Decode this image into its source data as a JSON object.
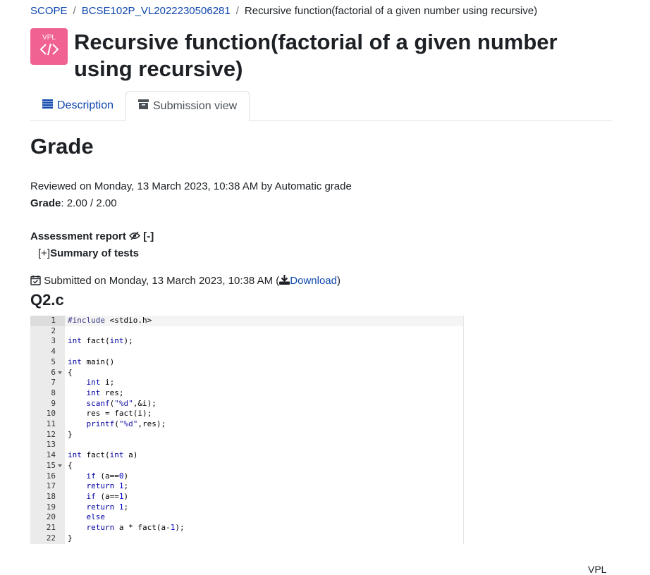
{
  "breadcrumb": {
    "items": [
      "SCOPE",
      "BCSE102P_VL2022230506281",
      "Recursive function(factorial of a given number using recursive)"
    ],
    "separator": "/"
  },
  "activity": {
    "logo_text": "VPL",
    "title": "Recursive function(factorial of a given number using recursive)"
  },
  "tabs": [
    {
      "label": "Description",
      "icon": "list-icon",
      "active": false
    },
    {
      "label": "Submission view",
      "icon": "archive-box-icon",
      "active": true
    }
  ],
  "grade": {
    "heading": "Grade",
    "reviewed_text": "Reviewed on Monday, 13 March 2023, 10:38 AM by Automatic grade",
    "grade_label": "Grade",
    "grade_value": ": 2.00 / 2.00"
  },
  "assessment": {
    "title": "Assessment report",
    "collapse_label": "[-]",
    "summary_toggle": "[+]",
    "summary_label": "Summary of tests"
  },
  "submission": {
    "submitted_text": "Submitted on Monday, 13 March 2023, 10:38 AM (",
    "download_label": "Download",
    "close_paren": ")",
    "filename": "Q2.c"
  },
  "code": {
    "line_numbers": [
      "1",
      "2",
      "3",
      "4",
      "5",
      "6",
      "7",
      "8",
      "9",
      "10",
      "11",
      "12",
      "13",
      "14",
      "15",
      "16",
      "17",
      "18",
      "19",
      "20",
      "21",
      "22"
    ],
    "fold_lines": [
      6,
      15
    ]
  },
  "footer": {
    "label": "VPL"
  },
  "colors": {
    "logo": "#f06292",
    "link": "#0f47ad"
  }
}
